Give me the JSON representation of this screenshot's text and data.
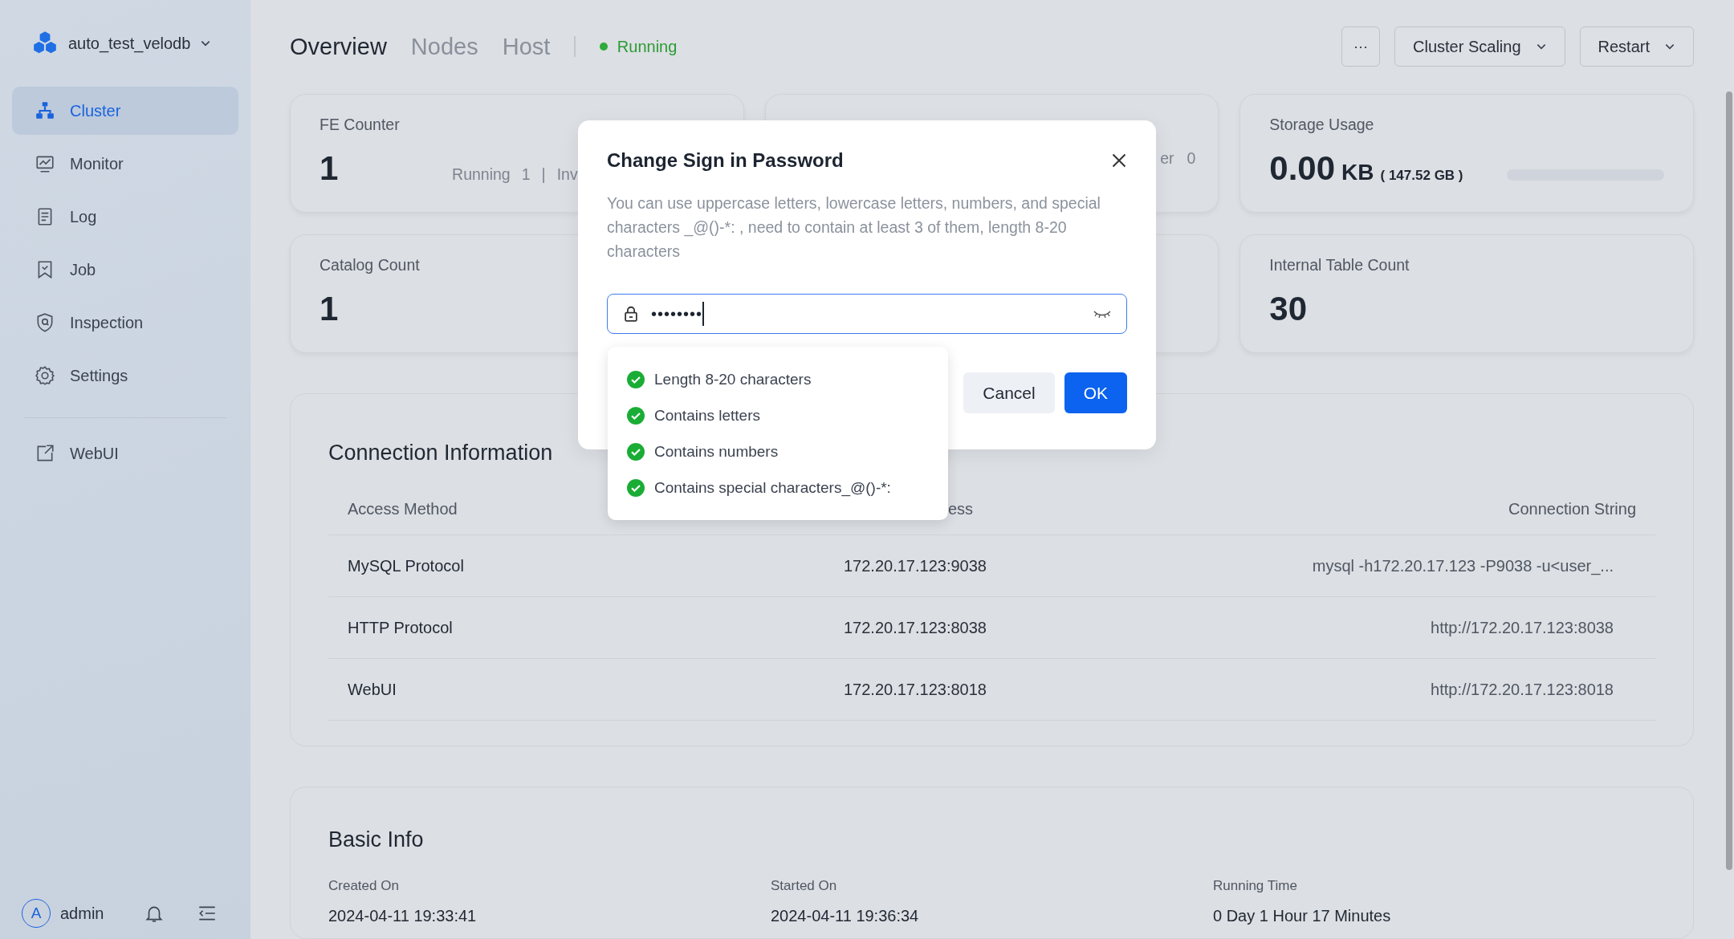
{
  "sidebar": {
    "cluster_name": "auto_test_velodb",
    "items": [
      {
        "label": "Cluster",
        "selected": true
      },
      {
        "label": "Monitor",
        "selected": false
      },
      {
        "label": "Log",
        "selected": false
      },
      {
        "label": "Job",
        "selected": false
      },
      {
        "label": "Inspection",
        "selected": false
      },
      {
        "label": "Settings",
        "selected": false
      }
    ],
    "links": [
      {
        "label": "WebUI"
      }
    ],
    "user": {
      "avatar": "A",
      "name": "admin"
    }
  },
  "header": {
    "tabs": [
      {
        "label": "Overview",
        "selected": true
      },
      {
        "label": "Nodes",
        "selected": false
      },
      {
        "label": "Host",
        "selected": false
      }
    ],
    "status": "Running",
    "more": "···",
    "buttons": [
      "Cluster Scaling",
      "Restart"
    ]
  },
  "cards": [
    {
      "label": "FE Counter",
      "value": "1",
      "status": [
        "Running",
        "1",
        "|",
        "Inv"
      ]
    },
    {
      "status": [
        "er",
        "0"
      ]
    },
    {
      "label": "Storage Usage",
      "value": "0.00",
      "unit": "KB",
      "total": "( 147.52 GB )",
      "level": 0
    },
    {
      "label": "Catalog Count",
      "value": "1"
    },
    {
      "label": "Internal Table Count",
      "value": "30"
    }
  ],
  "connection": {
    "title": "Connection Information",
    "columns": [
      "Access Method",
      "ess",
      "Connection String"
    ],
    "rows": [
      [
        "MySQL Protocol",
        "172.20.17.123:9038",
        "mysql -h172.20.17.123 -P9038 -u<user_..."
      ],
      [
        "HTTP Protocol",
        "172.20.17.123:8038",
        "http://172.20.17.123:8038"
      ],
      [
        "WebUI",
        "172.20.17.123:8018",
        "http://172.20.17.123:8018"
      ]
    ]
  },
  "basic_info": {
    "title": "Basic Info",
    "fields": [
      {
        "label": "Created On",
        "value": "2024-04-11 19:33:41"
      },
      {
        "label": "Started On",
        "value": "2024-04-11 19:36:34"
      },
      {
        "label": "Running Time",
        "value": "0 Day 1 Hour 17 Minutes"
      }
    ]
  },
  "dialog": {
    "title": "Change Sign in Password",
    "description": "You can use uppercase letters, lowercase letters, numbers, and special characters _@()-*: , need to contain at least 3 of them, length 8-20 characters",
    "password": {
      "value": "••••••••"
    },
    "rules": [
      {
        "text": "Length 8-20 characters",
        "checked": true
      },
      {
        "text": "Contains letters",
        "checked": true
      },
      {
        "text": "Contains numbers",
        "checked": true
      },
      {
        "text": "Contains special characters_@()-*:",
        "checked": true
      }
    ],
    "buttons": [
      "Cancel",
      "OK"
    ]
  }
}
